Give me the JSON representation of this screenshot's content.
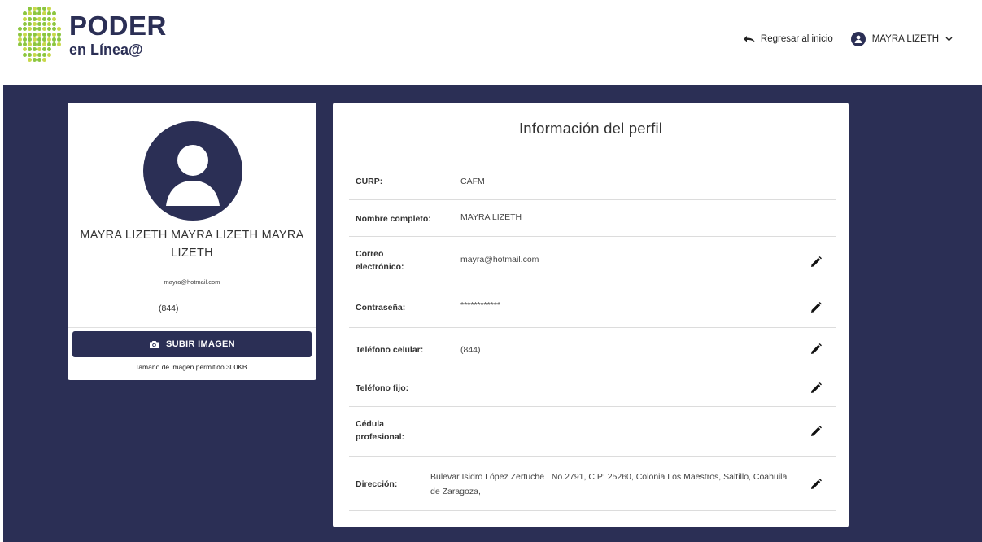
{
  "header": {
    "logo_title": "PODER",
    "logo_sub": "en Línea",
    "back_label": "Regresar al inicio",
    "user_name": "MAYRA LIZETH"
  },
  "colors": {
    "navy": "#2b2f55",
    "logo_green": "#8cc63f",
    "logo_lime": "#c8d84a"
  },
  "profile": {
    "name": "MAYRA LIZETH MAYRA LIZETH MAYRA LIZETH",
    "email": "mayra@hotmail.com",
    "phone": "(844)",
    "upload_label": "SUBIR IMAGEN",
    "upload_note": "Tamaño de imagen permitido 300KB."
  },
  "info": {
    "title": "Información del perfil",
    "rows": [
      {
        "label": "CURP:",
        "value": "CAFM",
        "editable": false
      },
      {
        "label": "Nombre completo:",
        "value": "MAYRA LIZETH",
        "editable": false
      },
      {
        "label": "Correo electrónico:",
        "value": "mayra@hotmail.com",
        "editable": true
      },
      {
        "label": "Contraseña:",
        "value": "************",
        "editable": true
      },
      {
        "label": "Teléfono celular:",
        "value": "(844)",
        "editable": true
      },
      {
        "label": "Teléfono fijo:",
        "value": "",
        "editable": true
      },
      {
        "label": "Cédula profesional:",
        "value": "",
        "editable": true
      },
      {
        "label": "Dirección:",
        "value": "Bulevar Isidro López Zertuche , No.2791, C.P: 25260, Colonia Los Maestros, Saltillo, Coahuila de Zaragoza,",
        "editable": true
      }
    ]
  }
}
